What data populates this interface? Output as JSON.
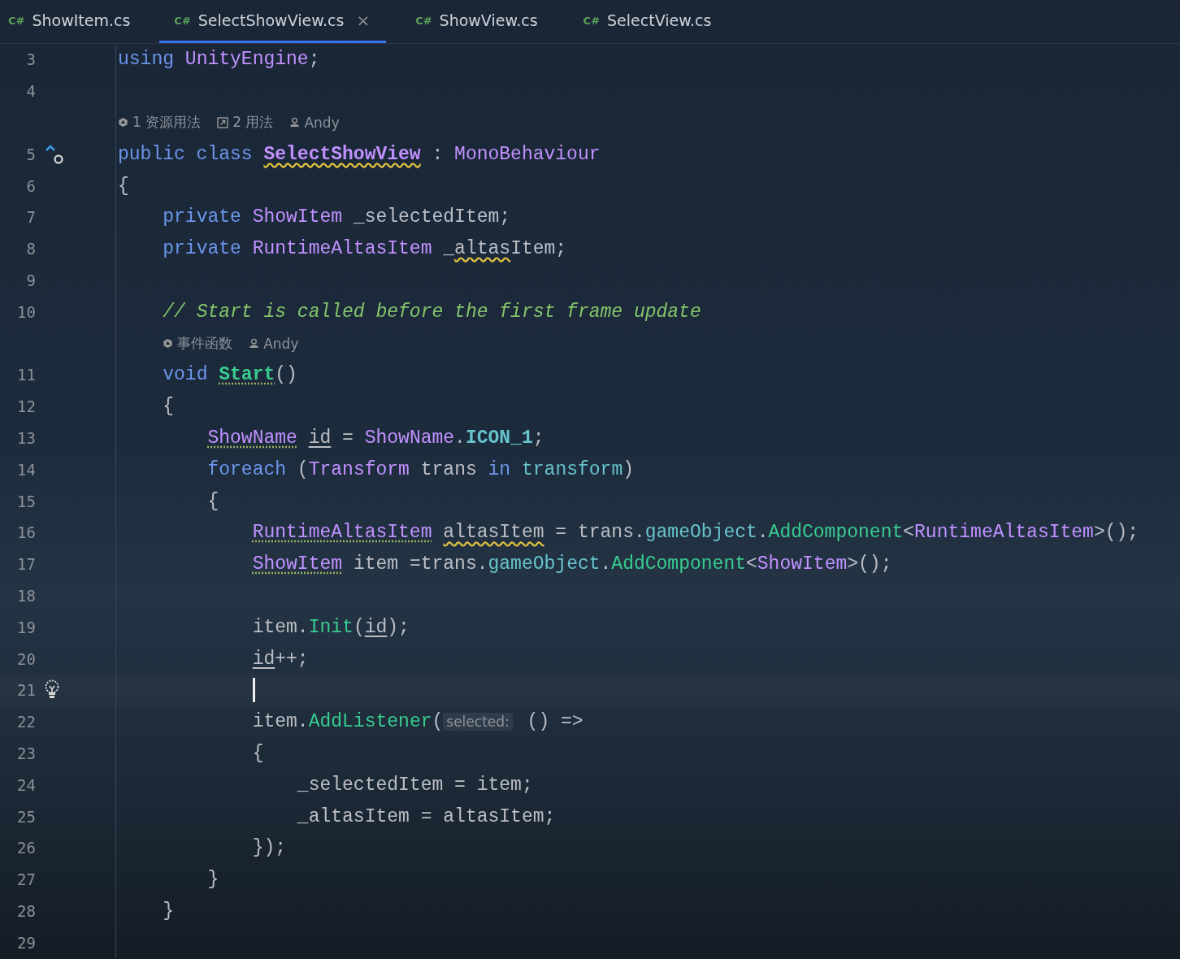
{
  "tabs": [
    {
      "lang": "C#",
      "label": "ShowItem.cs",
      "selected": false
    },
    {
      "lang": "C#",
      "label": "SelectShowView.cs",
      "selected": true,
      "close": "×"
    },
    {
      "lang": "C#",
      "label": "ShowView.cs",
      "selected": false
    },
    {
      "lang": "C#",
      "label": "SelectView.cs",
      "selected": false
    }
  ],
  "lines": [
    {
      "kind": "code",
      "number": "3",
      "current": false,
      "tokens": [
        {
          "t": "using ",
          "kind": "keyword"
        },
        {
          "t": "UnityEngine",
          "kind": "type"
        },
        {
          "t": ";",
          "kind": "plain"
        }
      ]
    },
    {
      "kind": "code",
      "number": "4",
      "current": false
    },
    {
      "kind": "hint",
      "items": [
        {
          "kind": "unity",
          "text": "1 资源用法"
        },
        {
          "kind": "usages",
          "text": "2 用法"
        },
        {
          "kind": "author",
          "text": "Andy"
        }
      ]
    },
    {
      "kind": "code",
      "number": "5",
      "current": false,
      "gutter": {
        "kind": "implements"
      },
      "tokens": [
        {
          "t": "public class ",
          "kind": "keyword"
        },
        {
          "t": "SelectShowView",
          "kind": "type",
          "bold": true,
          "underline": {
            "kind": "wavy"
          }
        },
        {
          "t": " : ",
          "kind": "plain"
        },
        {
          "t": "MonoBehaviour",
          "kind": "type"
        }
      ]
    },
    {
      "kind": "code",
      "number": "6",
      "current": false,
      "tokens": [
        {
          "t": "{",
          "kind": "plain"
        }
      ]
    },
    {
      "kind": "code",
      "number": "7",
      "current": false,
      "tokens": [
        {
          "t": "    private ",
          "kind": "keyword"
        },
        {
          "t": "ShowItem",
          "kind": "type"
        },
        {
          "t": " _selectedItem;",
          "kind": "plain"
        }
      ]
    },
    {
      "kind": "code",
      "number": "8",
      "current": false,
      "tokens": [
        {
          "t": "    private ",
          "kind": "keyword"
        },
        {
          "t": "RuntimeAltasItem",
          "kind": "type"
        },
        {
          "t": " _",
          "kind": "plain"
        },
        {
          "t": "altas",
          "kind": "plain",
          "underline": {
            "kind": "wavy"
          }
        },
        {
          "t": "Item;",
          "kind": "plain"
        }
      ]
    },
    {
      "kind": "code",
      "number": "9",
      "current": false
    },
    {
      "kind": "code",
      "number": "10",
      "current": false,
      "tokens": [
        {
          "t": "    // Start is called before the first frame update",
          "kind": "comment"
        }
      ]
    },
    {
      "kind": "hint",
      "items": [
        {
          "kind": "unity",
          "text": "事件函数"
        },
        {
          "kind": "author",
          "text": "Andy"
        }
      ]
    },
    {
      "kind": "code",
      "number": "11",
      "current": false,
      "tokens": [
        {
          "t": "    void ",
          "kind": "keyword"
        },
        {
          "t": "Start",
          "kind": "method",
          "bold": true,
          "underline": {
            "kind": "dotted"
          }
        },
        {
          "t": "()",
          "kind": "plain"
        }
      ]
    },
    {
      "kind": "code",
      "number": "12",
      "current": false,
      "tokens": [
        {
          "t": "    {",
          "kind": "plain"
        }
      ]
    },
    {
      "kind": "code",
      "number": "13",
      "current": false,
      "tokens": [
        {
          "t": "        ShowName",
          "kind": "type",
          "underline": {
            "kind": "dotted"
          }
        },
        {
          "t": " id",
          "kind": "plain",
          "underline": {
            "kind": "solid"
          }
        },
        {
          "t": " = ",
          "kind": "plain"
        },
        {
          "t": "ShowName",
          "kind": "type"
        },
        {
          "t": ".",
          "kind": "plain"
        },
        {
          "t": "ICON_1",
          "kind": "field",
          "bold": true
        },
        {
          "t": ";",
          "kind": "plain"
        }
      ]
    },
    {
      "kind": "code",
      "number": "14",
      "current": false,
      "tokens": [
        {
          "t": "        foreach",
          "kind": "keyword"
        },
        {
          "t": " (",
          "kind": "plain"
        },
        {
          "t": "Transform",
          "kind": "type"
        },
        {
          "t": " trans ",
          "kind": "plain"
        },
        {
          "t": "in ",
          "kind": "keyword"
        },
        {
          "t": "transform",
          "kind": "field"
        },
        {
          "t": ")",
          "kind": "plain"
        }
      ]
    },
    {
      "kind": "code",
      "number": "15",
      "current": false,
      "tokens": [
        {
          "t": "        {",
          "kind": "plain"
        }
      ]
    },
    {
      "kind": "code",
      "number": "16",
      "current": false,
      "tokens": [
        {
          "t": "            RuntimeAltasItem",
          "kind": "type",
          "underline": {
            "kind": "dotted"
          }
        },
        {
          "t": " altasItem",
          "kind": "plain",
          "underline": {
            "kind": "wavy"
          }
        },
        {
          "t": " = trans.",
          "kind": "plain"
        },
        {
          "t": "gameObject",
          "kind": "field"
        },
        {
          "t": ".",
          "kind": "plain"
        },
        {
          "t": "AddComponent",
          "kind": "method"
        },
        {
          "t": "<",
          "kind": "plain"
        },
        {
          "t": "RuntimeAltasItem",
          "kind": "type"
        },
        {
          "t": ">();",
          "kind": "plain"
        }
      ]
    },
    {
      "kind": "code",
      "number": "17",
      "current": false,
      "tokens": [
        {
          "t": "            ShowItem",
          "kind": "type",
          "underline": {
            "kind": "dotted"
          }
        },
        {
          "t": " item =trans.",
          "kind": "plain"
        },
        {
          "t": "gameObject",
          "kind": "field"
        },
        {
          "t": ".",
          "kind": "plain"
        },
        {
          "t": "AddComponent",
          "kind": "method"
        },
        {
          "t": "<",
          "kind": "plain"
        },
        {
          "t": "ShowItem",
          "kind": "type"
        },
        {
          "t": ">();",
          "kind": "plain"
        }
      ]
    },
    {
      "kind": "code",
      "number": "18",
      "current": false
    },
    {
      "kind": "code",
      "number": "19",
      "current": false,
      "tokens": [
        {
          "t": "            item.",
          "kind": "plain"
        },
        {
          "t": "Init",
          "kind": "method"
        },
        {
          "t": "(",
          "kind": "plain"
        },
        {
          "t": "id",
          "kind": "plain",
          "underline": {
            "kind": "solid"
          }
        },
        {
          "t": ");",
          "kind": "plain"
        }
      ]
    },
    {
      "kind": "code",
      "number": "20",
      "current": false,
      "tokens": [
        {
          "t": "            id",
          "kind": "plain",
          "underline": {
            "kind": "solid"
          }
        },
        {
          "t": "++;",
          "kind": "plain"
        }
      ]
    },
    {
      "kind": "code",
      "number": "21",
      "current": true,
      "gutter": {
        "kind": "bulb"
      }
    },
    {
      "kind": "code",
      "number": "22",
      "current": false,
      "tokens": [
        {
          "t": "            item.",
          "kind": "plain"
        },
        {
          "t": "AddListener",
          "kind": "method"
        },
        {
          "t": "(",
          "kind": "plain"
        },
        {
          "t": "selected:",
          "kind": "param"
        },
        {
          "t": " () =>",
          "kind": "plain"
        }
      ]
    },
    {
      "kind": "code",
      "number": "23",
      "current": false,
      "tokens": [
        {
          "t": "            {",
          "kind": "plain"
        }
      ]
    },
    {
      "kind": "code",
      "number": "24",
      "current": false,
      "tokens": [
        {
          "t": "                _selectedItem = item;",
          "kind": "plain"
        }
      ]
    },
    {
      "kind": "code",
      "number": "25",
      "current": false,
      "tokens": [
        {
          "t": "                _altasItem = altasItem;",
          "kind": "plain"
        }
      ]
    },
    {
      "kind": "code",
      "number": "26",
      "current": false,
      "tokens": [
        {
          "t": "            });",
          "kind": "plain"
        }
      ]
    },
    {
      "kind": "code",
      "number": "27",
      "current": false,
      "tokens": [
        {
          "t": "        }",
          "kind": "plain"
        }
      ]
    },
    {
      "kind": "code",
      "number": "28",
      "current": false,
      "tokens": [
        {
          "t": "    }",
          "kind": "plain"
        }
      ]
    },
    {
      "kind": "code",
      "number": "29",
      "current": false
    }
  ]
}
